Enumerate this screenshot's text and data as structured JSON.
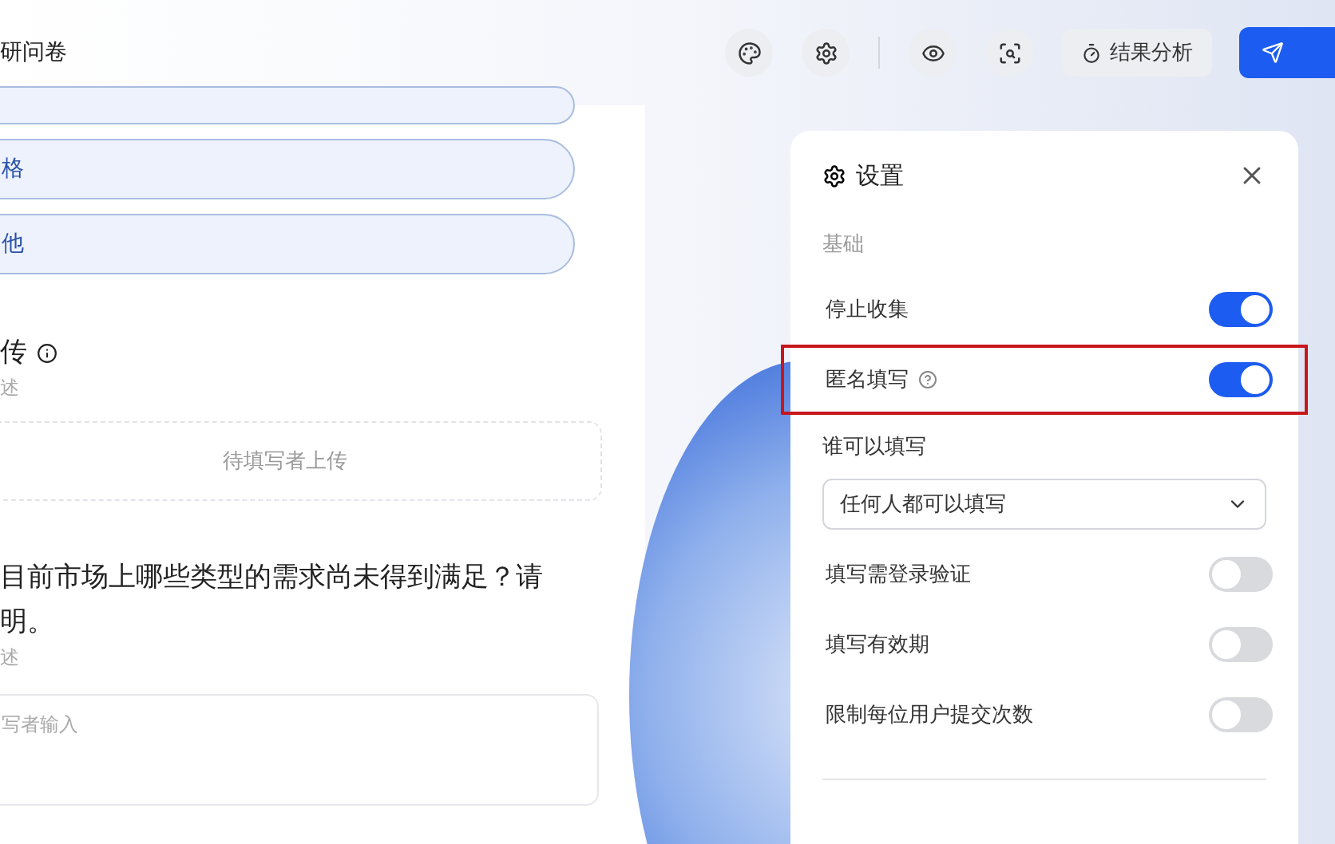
{
  "header": {
    "title": "研问卷",
    "result_button": "结果分析"
  },
  "questions": [
    {
      "kind": "options",
      "top_pill_cut": true,
      "options": [
        "格",
        "他"
      ]
    },
    {
      "kind": "upload",
      "title": "传",
      "description": "述",
      "upload_hint": "待填写者上传"
    },
    {
      "kind": "text",
      "title": "目前市场上哪些类型的需求尚未得到满足？请",
      "title_line_2": "明。",
      "description": "述",
      "placeholder": "写者输入"
    }
  ],
  "settings": {
    "title": "设置",
    "section": "基础",
    "rows": [
      {
        "kind": "toggle",
        "label": "停止收集",
        "on": true
      },
      {
        "kind": "toggle",
        "label": "匿名填写",
        "on": true,
        "help": true,
        "highlighted": true
      },
      {
        "kind": "label",
        "label": "谁可以填写"
      },
      {
        "kind": "select",
        "value": "任何人都可以填写"
      },
      {
        "kind": "toggle",
        "label": "填写需登录验证",
        "on": false
      },
      {
        "kind": "toggle",
        "label": "填写有效期",
        "on": false
      },
      {
        "kind": "toggle",
        "label": "限制每位用户提交次数",
        "on": false
      }
    ]
  }
}
